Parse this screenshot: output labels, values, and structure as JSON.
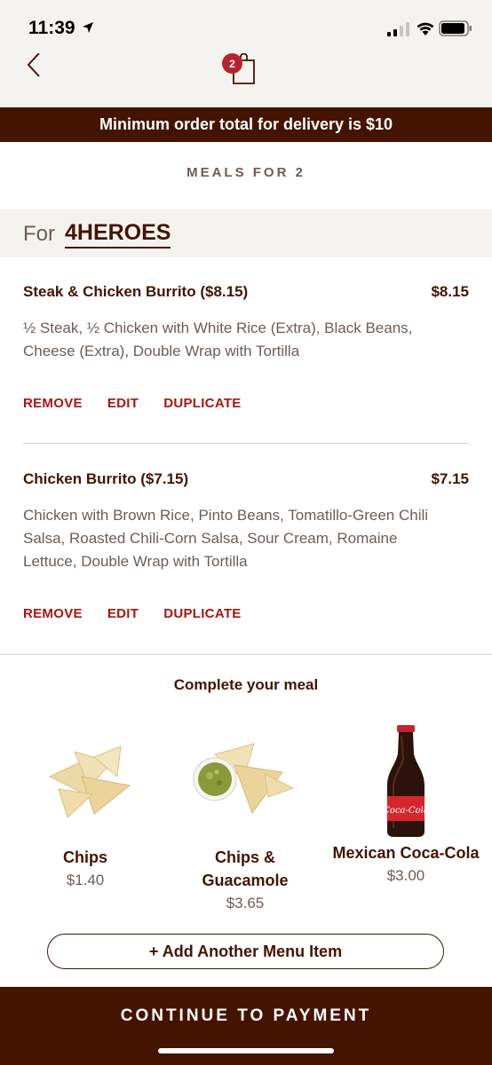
{
  "status_bar": {
    "time": "11:39"
  },
  "nav": {
    "bag_count": "2"
  },
  "banner": {
    "text": "Minimum order total for delivery is $10"
  },
  "meals_heading": "MEALS FOR 2",
  "for_row": {
    "label": "For",
    "name": "4HEROES"
  },
  "items": [
    {
      "title": "Steak & Chicken Burrito ($8.15)",
      "price": "$8.15",
      "description": "½ Steak, ½ Chicken with White Rice (Extra), Black Beans, Cheese (Extra), Double Wrap with Tortilla",
      "actions": [
        "REMOVE",
        "EDIT",
        "DUPLICATE"
      ]
    },
    {
      "title": "Chicken Burrito ($7.15)",
      "price": "$7.15",
      "description": "Chicken with Brown Rice, Pinto Beans, Tomatillo-Green Chili Salsa, Roasted Chili-Corn Salsa, Sour Cream, Romaine Lettuce, Double Wrap with Tortilla",
      "actions": [
        "REMOVE",
        "EDIT",
        "DUPLICATE"
      ]
    }
  ],
  "complete_meal": {
    "heading": "Complete your meal",
    "sides": [
      {
        "name": "Chips",
        "price": "$1.40",
        "icon": "chips-image"
      },
      {
        "name": "Chips & Guacamole",
        "price": "$3.65",
        "icon": "chips-guacamole-image"
      },
      {
        "name": "Mexican Coca-Cola",
        "price": "$3.00",
        "icon": "coca-cola-bottle-image",
        "bottle_label": "Coca-Cola"
      }
    ]
  },
  "add_item_label": "+ Add Another Menu Item",
  "continue_label": "CONTINUE TO PAYMENT",
  "colors": {
    "brand_brown": "#451400",
    "action_red": "#a81612",
    "badge_red": "#b8232e",
    "muted_text": "#6b5d55",
    "cream_bg": "#f5f3ef"
  }
}
